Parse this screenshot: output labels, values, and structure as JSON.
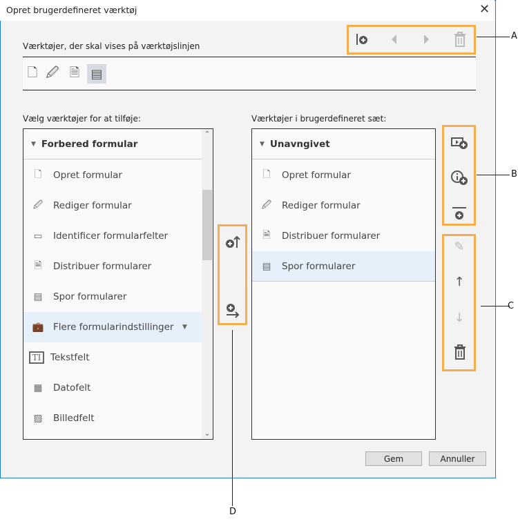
{
  "window": {
    "title": "Opret brugerdefineret værktøj",
    "close": "✕"
  },
  "toolbar_section": {
    "label": "Værktøjer, der skal vises på værktøjslinjen"
  },
  "left": {
    "label": "Vælg værktøjer for at tilføje:",
    "group": "Forbered formular",
    "items": [
      {
        "label": "Opret formular",
        "icon": "create-form-icon"
      },
      {
        "label": "Rediger formular",
        "icon": "edit-form-icon"
      },
      {
        "label": "Identificer formularfelter",
        "icon": "identify-fields-icon"
      },
      {
        "label": "Distribuer formularer",
        "icon": "distribute-forms-icon"
      },
      {
        "label": "Spor formularer",
        "icon": "track-forms-icon"
      },
      {
        "label": "Flere formularindstillinger",
        "icon": "briefcase-icon"
      },
      {
        "label": "Tekstfelt",
        "icon": "text-field-icon"
      },
      {
        "label": "Datofelt",
        "icon": "date-field-icon"
      },
      {
        "label": "Billedfelt",
        "icon": "image-field-icon"
      }
    ]
  },
  "right": {
    "label": "Værktøjer i brugerdefineret sæt:",
    "group": "Unavngivet",
    "items": [
      {
        "label": "Opret formular"
      },
      {
        "label": "Rediger formular"
      },
      {
        "label": "Distribuer formularer"
      },
      {
        "label": "Spor formularer"
      }
    ]
  },
  "callouts": {
    "a": "A",
    "b": "B",
    "c": "C",
    "d": "D"
  },
  "buttons": {
    "save": "Gem",
    "cancel": "Annuller"
  },
  "colors": {
    "callout": "#f6ad4e",
    "selected": "#e6f0fa"
  }
}
